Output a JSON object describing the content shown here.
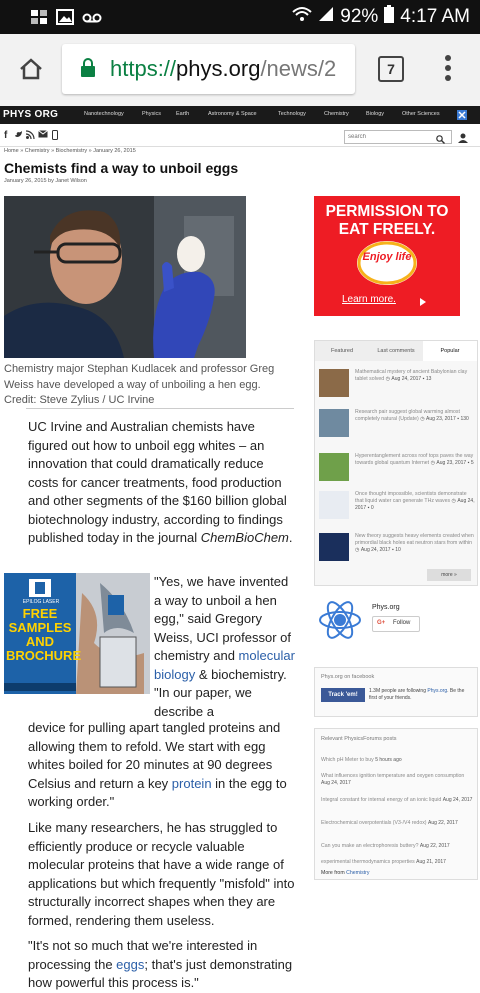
{
  "status_bar": {
    "time": "4:17 AM",
    "battery": "92%"
  },
  "browser": {
    "url_scheme": "https://",
    "url_host": "phys.org",
    "url_path": "/news/2",
    "tab_count": "7"
  },
  "site_nav": {
    "logo": "PHYS ORG",
    "items": [
      "Nanotechnology",
      "Physics",
      "Earth",
      "Astronomy & Space",
      "Technology",
      "Chemistry",
      "Biology",
      "Other Sciences"
    ],
    "search_placeholder": "search"
  },
  "article": {
    "breadcrumb": "Home  »  Chemistry  »  Biochemistry  »  January 26, 2015",
    "title": "Chemists find a way to unboil eggs",
    "byline": "January 26, 2015 by Janet Wilson",
    "caption": "Chemistry major Stephan Kudlacek and professor Greg Weiss have developed a way of unboiling a hen egg. Credit: Steve Zylius / UC Irvine",
    "para1_text": "UC Irvine and Australian chemists have figured out how to unboil egg whites – an innovation that could dramatically reduce costs for cancer treatments, food production and other segments of the $160 billion global biotechnology industry, according to findings published today in the journal ",
    "para1_journal": "ChemBioChem",
    "para1_end": ".",
    "para2_part1": "\"Yes, we have invented a way to unboil a hen egg,\" said Gregory Weiss, UCI professor of chemistry and ",
    "para2_link": "molecular biology",
    "para2_part2": " & biochemistry. \"In our paper, we describe a",
    "para2b_part1": "device for pulling apart tangled proteins and allowing them to refold. We start with egg whites boiled for 20 minutes at 90 degrees Celsius and return a key ",
    "para2b_link": "protein",
    "para2b_part2": " in the egg to working order.\"",
    "para3": "Like many researchers, he has struggled to efficiently produce or recycle valuable molecular proteins that have a wide range of applications but which frequently \"misfold\" into structurally incorrect shapes when they are formed, rendering them useless.",
    "para4_part1": "\"It's not so much that we're interested in processing the ",
    "para4_link": "eggs",
    "para4_part2": "; that's just demonstrating how powerful this process is.\""
  },
  "book_ad": {
    "brand": "EPILOG LASER",
    "text": "FREE SAMPLES AND BROCHURE"
  },
  "ad": {
    "headline": "PERMISSION TO EAT FREELY.",
    "brand": "Enjoy life",
    "cta": "Learn more."
  },
  "tabs": {
    "labels": [
      "Featured",
      "Last comments",
      "Popular"
    ],
    "items": [
      {
        "title": "Mathematical mystery of ancient Babylonian clay tablet solved",
        "date": "Aug 24, 2017",
        "count": "13"
      },
      {
        "title": "Research pair suggest global warming almost completely natural (Update)",
        "date": "Aug 23, 2017",
        "count": "130"
      },
      {
        "title": "Hyperentanglement across roof tops paves the way towards global quantum Internet",
        "date": "Aug 23, 2017",
        "count": "5"
      },
      {
        "title": "Once thought impossible, scientists demonstrate that liquid water can generate THz waves",
        "date": "Aug 24, 2017",
        "count": "0"
      },
      {
        "title": "New theory suggests heavy elements created when primordial black holes eat neutron stars from within",
        "date": "Aug 24, 2017",
        "count": "10"
      }
    ],
    "more": "more »"
  },
  "physorg": {
    "name": "Phys.org",
    "follow": "Follow"
  },
  "facebook": {
    "header": "Phys.org on facebook",
    "button": "Track 'em!",
    "text_prefix": "1.3M people are following ",
    "text_link": "Phys.org",
    "text_suffix": ". Be the first of your friends."
  },
  "forums": {
    "header": "Relevant PhysicsForums posts",
    "items": [
      {
        "title": "Which pH Meter to buy",
        "date": "5 hours ago"
      },
      {
        "title": "What influences ignition temperature and oxygen consumption",
        "date": "Aug 24, 2017"
      },
      {
        "title": "Integral constant for internal energy of an ionic liquid",
        "date": "Aug 24, 2017"
      },
      {
        "title": "Electrochemical overpotentials (V3-/V4 redox)",
        "date": "Aug 22, 2017"
      },
      {
        "title": "Can you make an electrophoresis buttery?",
        "date": "Aug 22, 2017"
      },
      {
        "title": "experimental thermodynamics properties",
        "date": "Aug 21, 2017"
      }
    ],
    "more_label": "More from ",
    "more_link": "Chemistry"
  }
}
